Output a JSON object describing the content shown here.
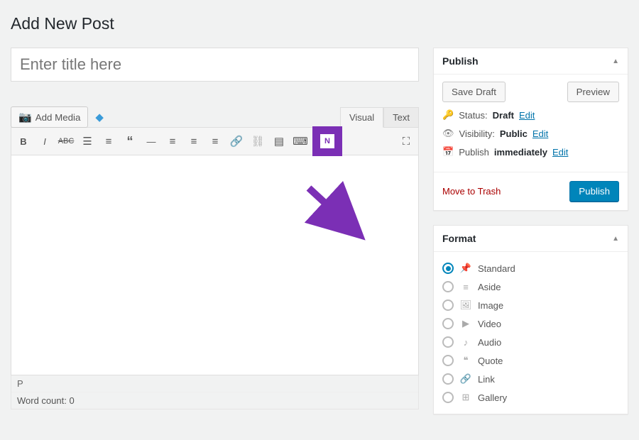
{
  "page_title": "Add New Post",
  "title_placeholder": "Enter title here",
  "add_media_label": "Add Media",
  "editor_tabs": {
    "visual": "Visual",
    "text": "Text"
  },
  "status_path": "P",
  "word_count_label": "Word count: 0",
  "publish_panel": {
    "title": "Publish",
    "save_draft": "Save Draft",
    "preview": "Preview",
    "status_label": "Status:",
    "status_value": "Draft",
    "visibility_label": "Visibility:",
    "visibility_value": "Public",
    "schedule_label": "Publish",
    "schedule_value": "immediately",
    "edit": "Edit",
    "trash": "Move to Trash",
    "publish_btn": "Publish"
  },
  "format_panel": {
    "title": "Format",
    "items": [
      {
        "label": "Standard",
        "checked": true
      },
      {
        "label": "Aside",
        "checked": false
      },
      {
        "label": "Image",
        "checked": false
      },
      {
        "label": "Video",
        "checked": false
      },
      {
        "label": "Audio",
        "checked": false
      },
      {
        "label": "Quote",
        "checked": false
      },
      {
        "label": "Link",
        "checked": false
      },
      {
        "label": "Gallery",
        "checked": false
      }
    ]
  }
}
